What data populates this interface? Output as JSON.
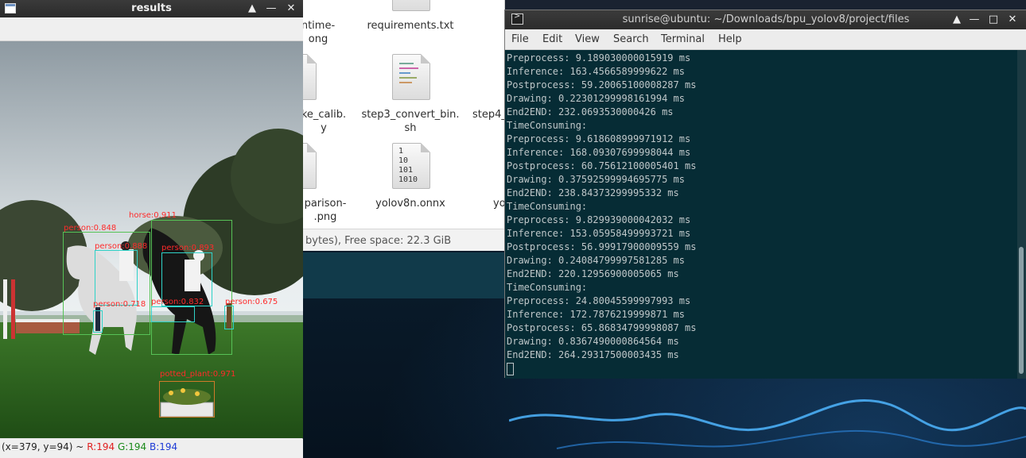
{
  "results_window": {
    "title": "results",
    "status": {
      "coords": "(x=379, y=94) ~",
      "r": "R:194",
      "g": "G:194",
      "b": "B:194"
    },
    "detections": [
      {
        "label": "horse:0.911"
      },
      {
        "label": "person:0.848"
      },
      {
        "label": "person:0.888"
      },
      {
        "label": "person:0.893"
      },
      {
        "label": "person:0.718"
      },
      {
        "label": "person:0.832"
      },
      {
        "label": "person:0.675"
      },
      {
        "label": "potted_plant:0.971"
      }
    ]
  },
  "file_manager": {
    "items": [
      {
        "name": "ntime-\nong"
      },
      {
        "name": "requirements.txt"
      },
      {
        "name": "ke_calib.\ny"
      },
      {
        "name": "step3_convert_bin.\nsh"
      },
      {
        "name": "step4_"
      },
      {
        "name": "parison-\n.png"
      },
      {
        "name": "yolov8n.onnx"
      },
      {
        "name": "yo"
      }
    ],
    "status": "bytes), Free space: 22.3 GiB"
  },
  "terminal": {
    "title": "sunrise@ubuntu: ~/Downloads/bpu_yolov8/project/files",
    "menu": [
      "File",
      "Edit",
      "View",
      "Search",
      "Terminal",
      "Help"
    ],
    "lines": [
      "Preprocess: 9.189030000015919 ms",
      "Inference: 163.4566589999622 ms",
      "Postprocess: 59.20065100008287 ms",
      "Drawing: 0.22301299998161994 ms",
      "End2END: 232.0693530000426 ms",
      "TimeConsuming:",
      "Preprocess: 9.618608999971912 ms",
      "Inference: 168.09307699998044 ms",
      "Postprocess: 60.75612100005401 ms",
      "Drawing: 0.37592599994695775 ms",
      "End2END: 238.84373299995332 ms",
      "TimeConsuming:",
      "Preprocess: 9.829939000042032 ms",
      "Inference: 153.05958499993721 ms",
      "Postprocess: 56.99917900009559 ms",
      "Drawing: 0.24084799997581285 ms",
      "End2END: 220.12956900005065 ms",
      "TimeConsuming:",
      "Preprocess: 24.80045599997993 ms",
      "Inference: 172.7876219999871 ms",
      "Postprocess: 65.86834799998087 ms",
      "Drawing: 0.8367490000864564 ms",
      "End2END: 264.29317500003435 ms"
    ]
  }
}
